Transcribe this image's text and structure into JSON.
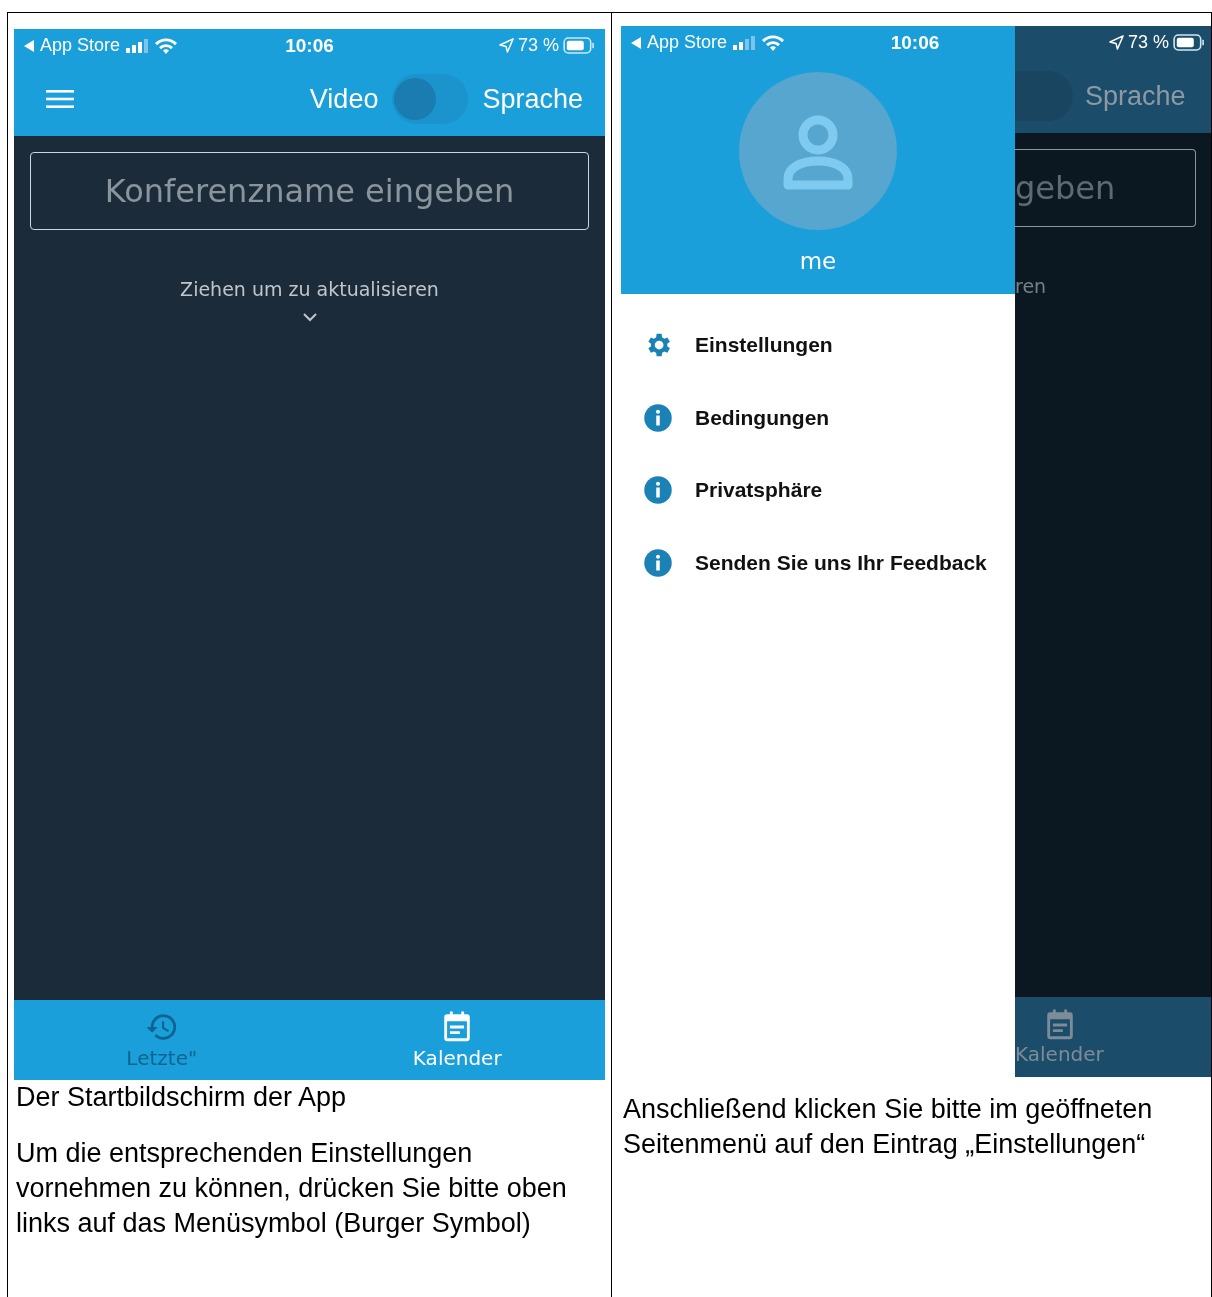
{
  "left_cell": {
    "phone": {
      "status_bar": {
        "back_label": "App Store",
        "time": "10:06",
        "battery": "73 %"
      },
      "header": {
        "toggle_left": "Video",
        "toggle_right": "Sprache",
        "toggle": {
          "on": false
        }
      },
      "conference_field": {
        "placeholder": "Konferenzname eingeben"
      },
      "pull_hint": "Ziehen um zu aktualisieren",
      "tabs": [
        {
          "label": "Letzte\"",
          "kind": "history",
          "selected": false
        },
        {
          "label": "Kalender",
          "kind": "calendar",
          "selected": true
        }
      ]
    },
    "captions": [
      "Der Startbildschirm der App",
      "Um die entsprechenden Einstellungen vornehmen zu können, drücken Sie bitte oben links auf das Menüsymbol (Burger Symbol)"
    ]
  },
  "right_cell": {
    "phone": {
      "status_bar": {
        "back_label": "App Store",
        "time": "10:06",
        "battery": "73 %"
      },
      "drawer": {
        "user_name": "me",
        "items": [
          {
            "label": "Einstellungen",
            "kind": "settings"
          },
          {
            "label": "Bedingungen",
            "kind": "info"
          },
          {
            "label": "Privatsphäre",
            "kind": "info"
          },
          {
            "label": "Senden Sie uns Ihr Feedback",
            "kind": "info"
          }
        ]
      },
      "background": {
        "toggle_right": "Sprache",
        "field_fragment": "geben",
        "hint_fragment": "ren",
        "tab_label": "Kalender"
      }
    },
    "captions": [
      "Anschließend klicken Sie bitte im geöffneten Seitenmenü auf den Eintrag „Einstellungen“"
    ]
  }
}
